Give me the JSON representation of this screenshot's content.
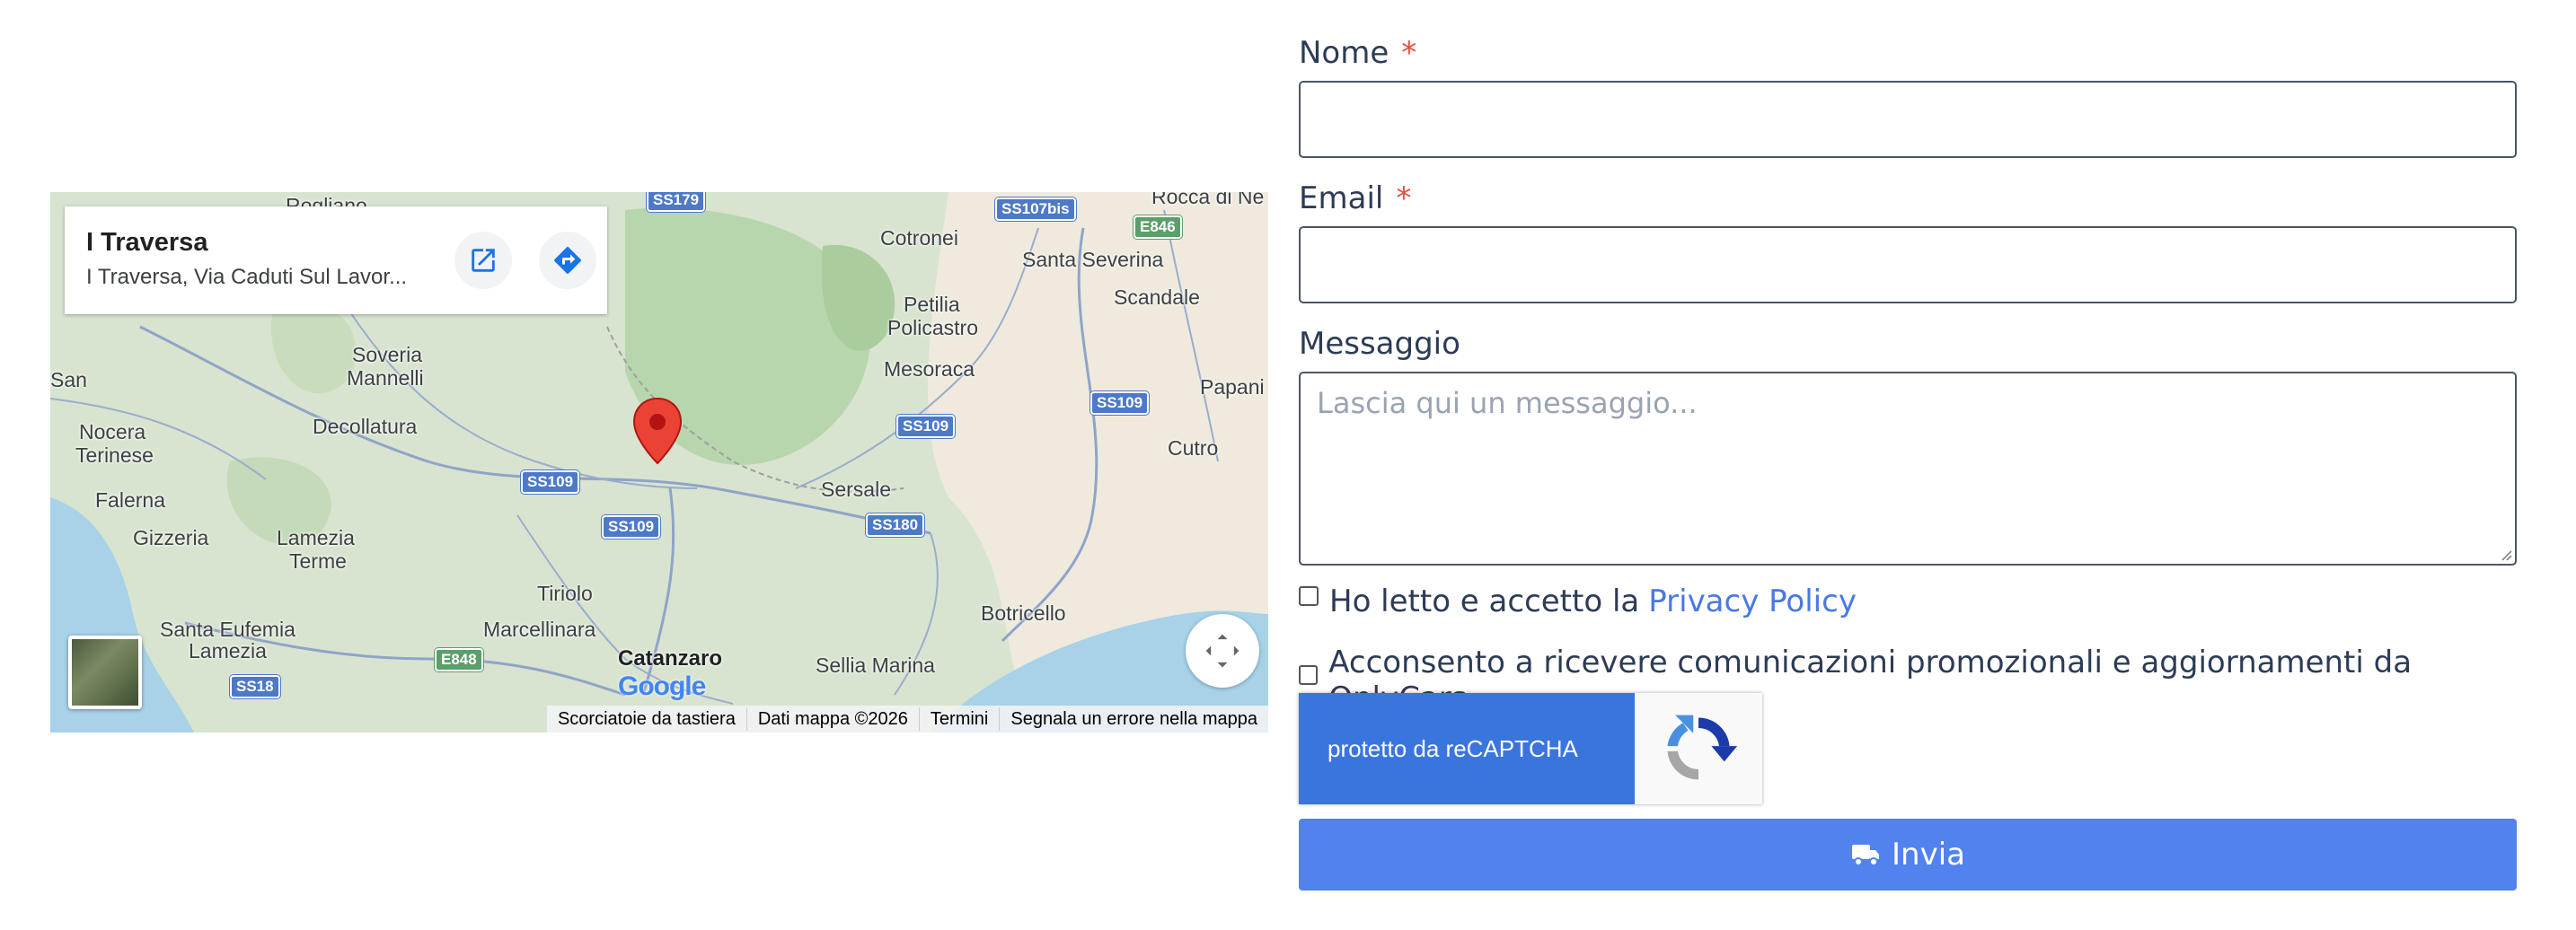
{
  "map": {
    "place_card": {
      "title": "I Traversa",
      "address": "I Traversa, Via Caduti Sul Lavor..."
    },
    "labels": [
      {
        "text": "Rogliano"
      },
      {
        "text": "Rocca di Ne"
      },
      {
        "text": "Cotronei"
      },
      {
        "text": "Santa Severina"
      },
      {
        "text": "Scandale"
      },
      {
        "text": "Petilia"
      },
      {
        "text": "Policastro"
      },
      {
        "text": "Mesoraca"
      },
      {
        "text": "Soveria"
      },
      {
        "text": "Mannelli"
      },
      {
        "text": "San"
      },
      {
        "text": "Nocera"
      },
      {
        "text": "Terinese"
      },
      {
        "text": "Decollatura"
      },
      {
        "text": "Papani"
      },
      {
        "text": "Cutro"
      },
      {
        "text": "Sersale"
      },
      {
        "text": "Falerna"
      },
      {
        "text": "Gizzeria"
      },
      {
        "text": "Lamezia"
      },
      {
        "text": "Terme"
      },
      {
        "text": "Tiriolo"
      },
      {
        "text": "Botricello"
      },
      {
        "text": "Santa Eufemia"
      },
      {
        "text": "Lamezia"
      },
      {
        "text": "Marcellinara"
      },
      {
        "text": "Catanzaro"
      },
      {
        "text": "Sellia Marina"
      }
    ],
    "shields": [
      {
        "text": "SS179"
      },
      {
        "text": "SS107bis"
      },
      {
        "text": "E846"
      },
      {
        "text": "SS109"
      },
      {
        "text": "SS109"
      },
      {
        "text": "SS109"
      },
      {
        "text": "SS109"
      },
      {
        "text": "SS180"
      },
      {
        "text": "E848"
      },
      {
        "text": "SS18"
      }
    ],
    "google_logo": "Google",
    "attribution": [
      "Scorciatoie da tastiera",
      "Dati mappa ©2026",
      "Termini",
      "Segnala un errore nella mappa"
    ]
  },
  "form": {
    "name_label": "Nome",
    "email_label": "Email",
    "required_mark": "*",
    "message_label": "Messaggio",
    "message_placeholder": "Lascia qui un messaggio...",
    "privacy_text": "Ho letto e accetto la ",
    "privacy_link": "Privacy Policy",
    "consent_text": "Acconsento a ricevere comunicazioni promozionali e aggiornamenti da OnlyCars.",
    "recaptcha_text": "protetto da reCAPTCHA",
    "submit_label": "Invia"
  },
  "colors": {
    "submit_bg": "#5282ee",
    "link": "#4a78e4",
    "required": "#e74c3c",
    "recaptcha_blue": "#3a75de"
  }
}
